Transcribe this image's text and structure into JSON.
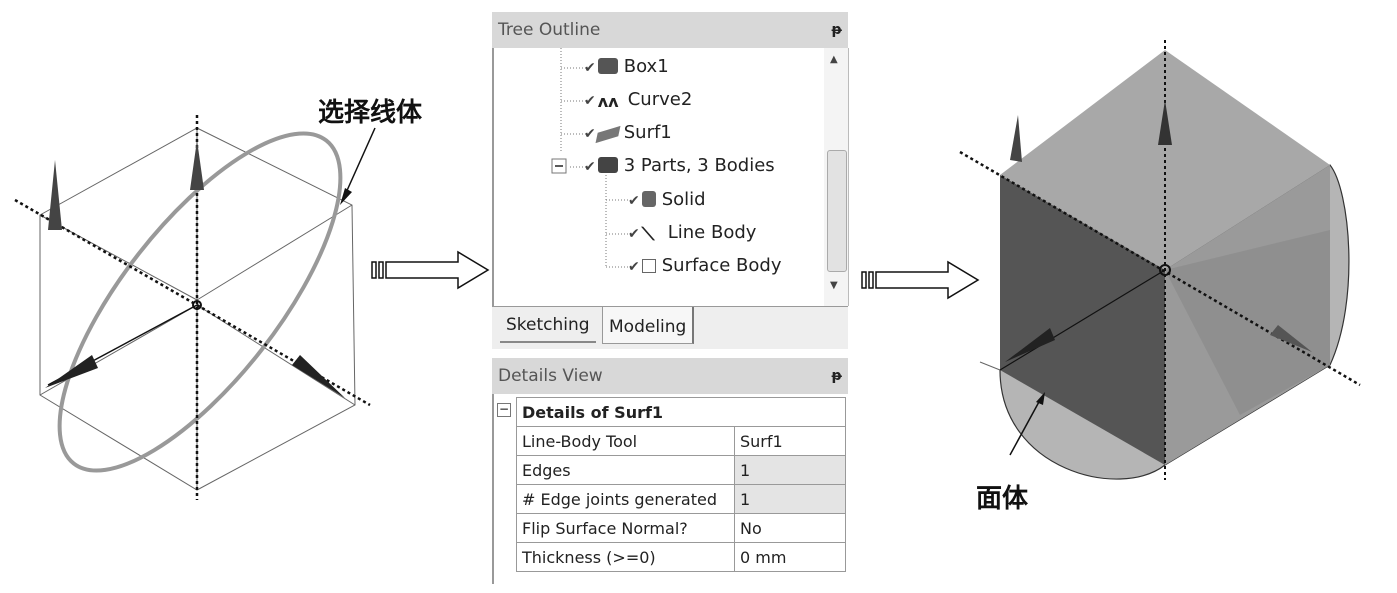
{
  "annotations": {
    "select_line_body": "选择线体",
    "surface_body": "面体"
  },
  "tree_outline": {
    "title": "Tree Outline",
    "items": [
      {
        "label": "Box1",
        "icon": "box-icon"
      },
      {
        "label": "Curve2",
        "icon": "curve-icon"
      },
      {
        "label": "Surf1",
        "icon": "surface-icon"
      },
      {
        "label": "3 Parts, 3 Bodies",
        "icon": "parts-icon"
      },
      {
        "label": "Solid",
        "icon": "solid-icon"
      },
      {
        "label": "Line Body",
        "icon": "line-body-icon"
      },
      {
        "label": "Surface Body",
        "icon": "surface-body-icon"
      }
    ],
    "tabs": [
      {
        "label": "Sketching"
      },
      {
        "label": "Modeling",
        "active": true
      }
    ]
  },
  "details_view": {
    "title": "Details View",
    "group": "Details of Surf1",
    "rows": [
      {
        "label": "Line-Body Tool",
        "value": "Surf1"
      },
      {
        "label": "Edges",
        "value": "1"
      },
      {
        "label": "# Edge joints generated",
        "value": "1"
      },
      {
        "label": "Flip Surface Normal?",
        "value": "No"
      },
      {
        "label": "Thickness (>=0)",
        "value": "0 mm"
      }
    ]
  }
}
